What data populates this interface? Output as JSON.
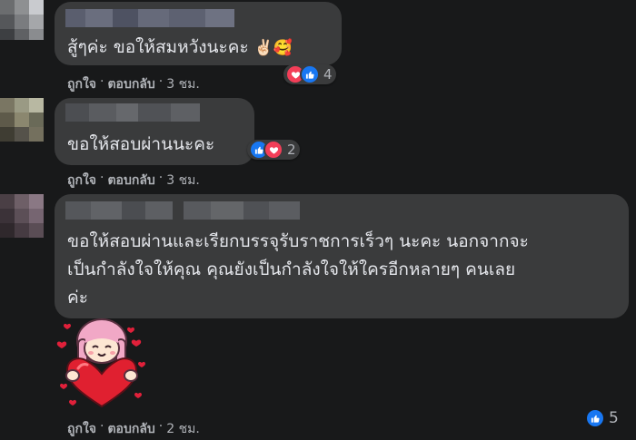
{
  "colors": {
    "background": "#18191a",
    "bubble": "#3a3b3c",
    "text": "#e4e6eb",
    "secondary": "#b0b3b8",
    "like": "#1877f2",
    "love": "#f33e58"
  },
  "comments": [
    {
      "text_lines": [
        "สู้ๆค่ะ ขอให้สมหวังนะคะ"
      ],
      "emojis": [
        "✌🏻",
        "🥰"
      ],
      "actions": {
        "like": "ถูกใจ",
        "reply": "ตอบกลับ",
        "time": "3 ชม."
      },
      "reactions": {
        "icons": [
          "love-icon",
          "like-icon"
        ],
        "count": "4"
      }
    },
    {
      "text_lines": [
        "ขอให้สอบผ่านนะคะ"
      ],
      "actions": {
        "like": "ถูกใจ",
        "reply": "ตอบกลับ",
        "time": "3 ชม."
      },
      "reactions": {
        "icons": [
          "like-icon",
          "love-icon"
        ],
        "count": "2"
      }
    },
    {
      "text_lines": [
        "ขอให้สอบผ่านและเรียกบรรจุรับราชการเร็วๆ นะคะ นอกจากจะ",
        "เป็นกำลังใจให้คุณ คุณยังเป็นกำลังใจให้ใครอีกหลายๆ คนเลย",
        "ค่ะ"
      ],
      "sticker": "heart-hug-sticker",
      "actions": {
        "like": "ถูกใจ",
        "reply": "ตอบกลับ",
        "time": "2 ชม."
      },
      "reactions": {
        "icons": [
          "like-icon"
        ],
        "count": "5"
      }
    }
  ],
  "separator": "·"
}
